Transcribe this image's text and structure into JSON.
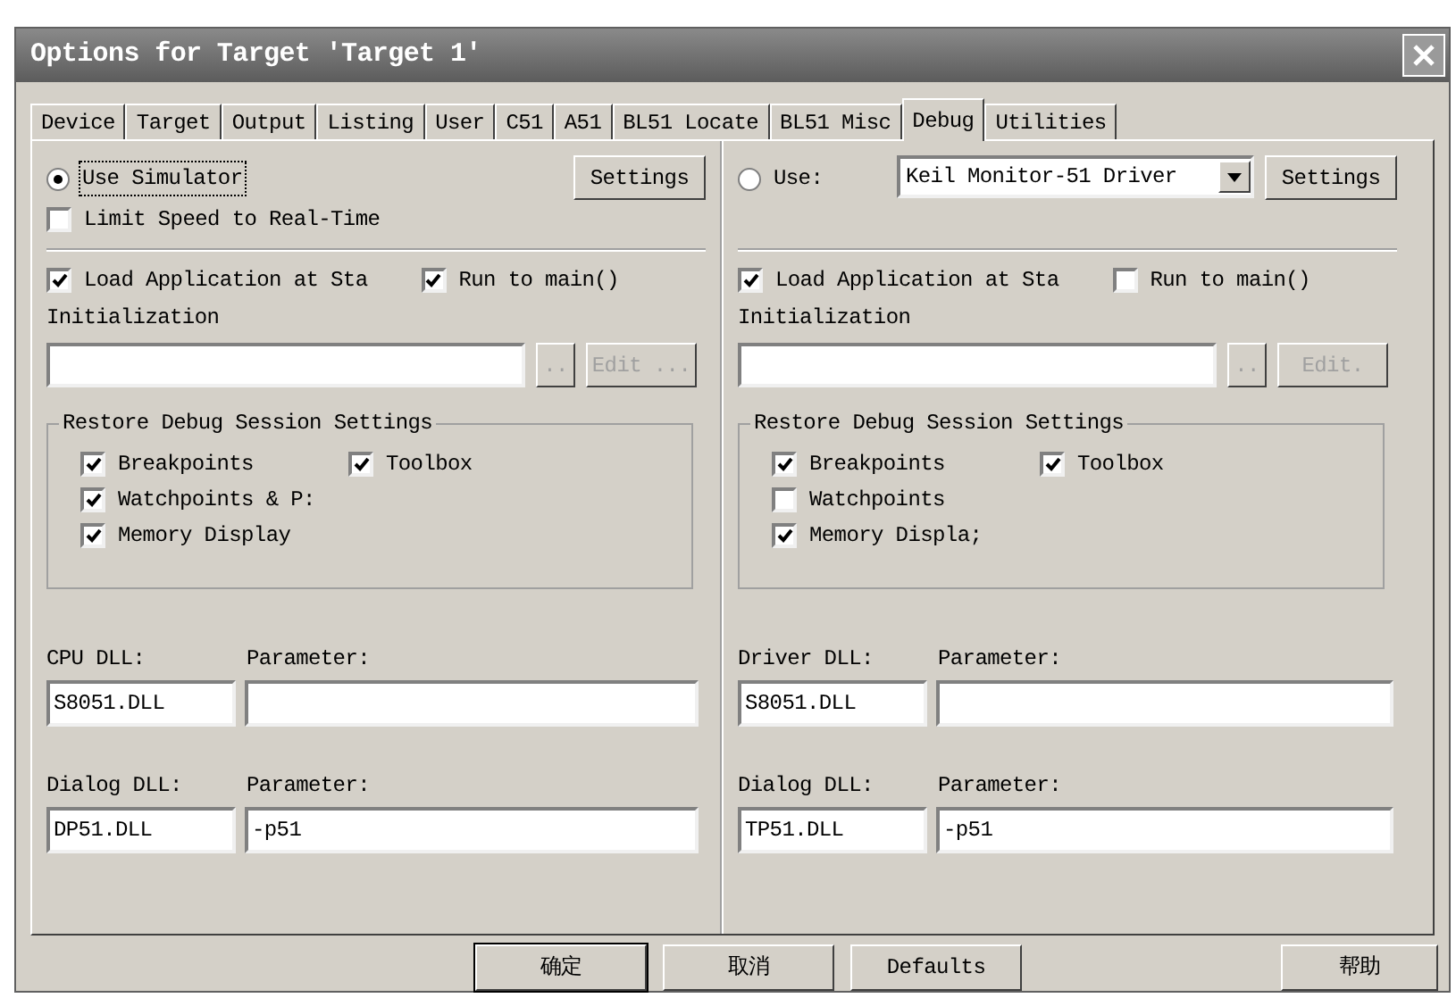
{
  "window": {
    "title": "Options for Target 'Target 1'"
  },
  "tabs": [
    {
      "label": "Device",
      "selected": false
    },
    {
      "label": "Target",
      "selected": false
    },
    {
      "label": "Output",
      "selected": false
    },
    {
      "label": "Listing",
      "selected": false
    },
    {
      "label": "User",
      "selected": false
    },
    {
      "label": "C51",
      "selected": false
    },
    {
      "label": "A51",
      "selected": false
    },
    {
      "label": "BL51 Locate",
      "selected": false
    },
    {
      "label": "BL51 Misc",
      "selected": false
    },
    {
      "label": "Debug",
      "selected": true
    },
    {
      "label": "Utilities",
      "selected": false
    }
  ],
  "left": {
    "mode": {
      "label": "Use Simulator",
      "selected": true
    },
    "settings": "Settings",
    "limit_speed": {
      "label": "Limit Speed to Real-Time",
      "checked": false
    },
    "load_app": {
      "label": "Load Application at Sta",
      "checked": true
    },
    "run_main": {
      "label": "Run to main()",
      "checked": true
    },
    "init_label": "Initialization",
    "browse": "..",
    "edit": {
      "label": "Edit ...",
      "disabled": true
    },
    "group_title": "Restore Debug Session Settings",
    "restore": [
      {
        "label": "Breakpoints",
        "checked": true
      },
      {
        "label": "Toolbox",
        "checked": true
      },
      {
        "label": "Watchpoints & P:",
        "checked": true
      },
      {
        "label": "Memory Display",
        "checked": true
      }
    ],
    "dll_rows": [
      {
        "dll_label": "CPU DLL:",
        "param_label": "Parameter:",
        "dll": "S8051.DLL"
      },
      {
        "dll_label": "Dialog DLL:",
        "param_label": "Parameter:",
        "dll": "DP51.DLL",
        "param": "-p51"
      }
    ]
  },
  "right": {
    "mode": {
      "label": "Use:",
      "selected": false
    },
    "driver": "Keil Monitor-51 Driver",
    "settings": "Settings",
    "load_app": {
      "label": "Load Application at Sta",
      "checked": true
    },
    "run_main": {
      "label": "Run to main()",
      "checked": false
    },
    "init_label": "Initialization",
    "browse": "..",
    "edit": {
      "label": "Edit.",
      "disabled": true
    },
    "group_title": "Restore Debug Session Settings",
    "restore": [
      {
        "label": "Breakpoints",
        "checked": true
      },
      {
        "label": "Toolbox",
        "checked": true
      },
      {
        "label": "Watchpoints",
        "checked": false
      },
      {
        "label": "Memory Displa;",
        "checked": true
      }
    ],
    "dll_rows": [
      {
        "dll_label": "Driver DLL:",
        "param_label": "Parameter:",
        "dll": "S8051.DLL"
      },
      {
        "dll_label": "Dialog DLL:",
        "param_label": "Parameter:",
        "dll": "TP51.DLL",
        "param": "-p51"
      }
    ]
  },
  "buttons": [
    {
      "label": "确定",
      "default": true
    },
    {
      "label": "取消",
      "default": false
    },
    {
      "label": "Defaults",
      "default": false
    },
    {
      "label": "帮助",
      "default": false
    }
  ]
}
